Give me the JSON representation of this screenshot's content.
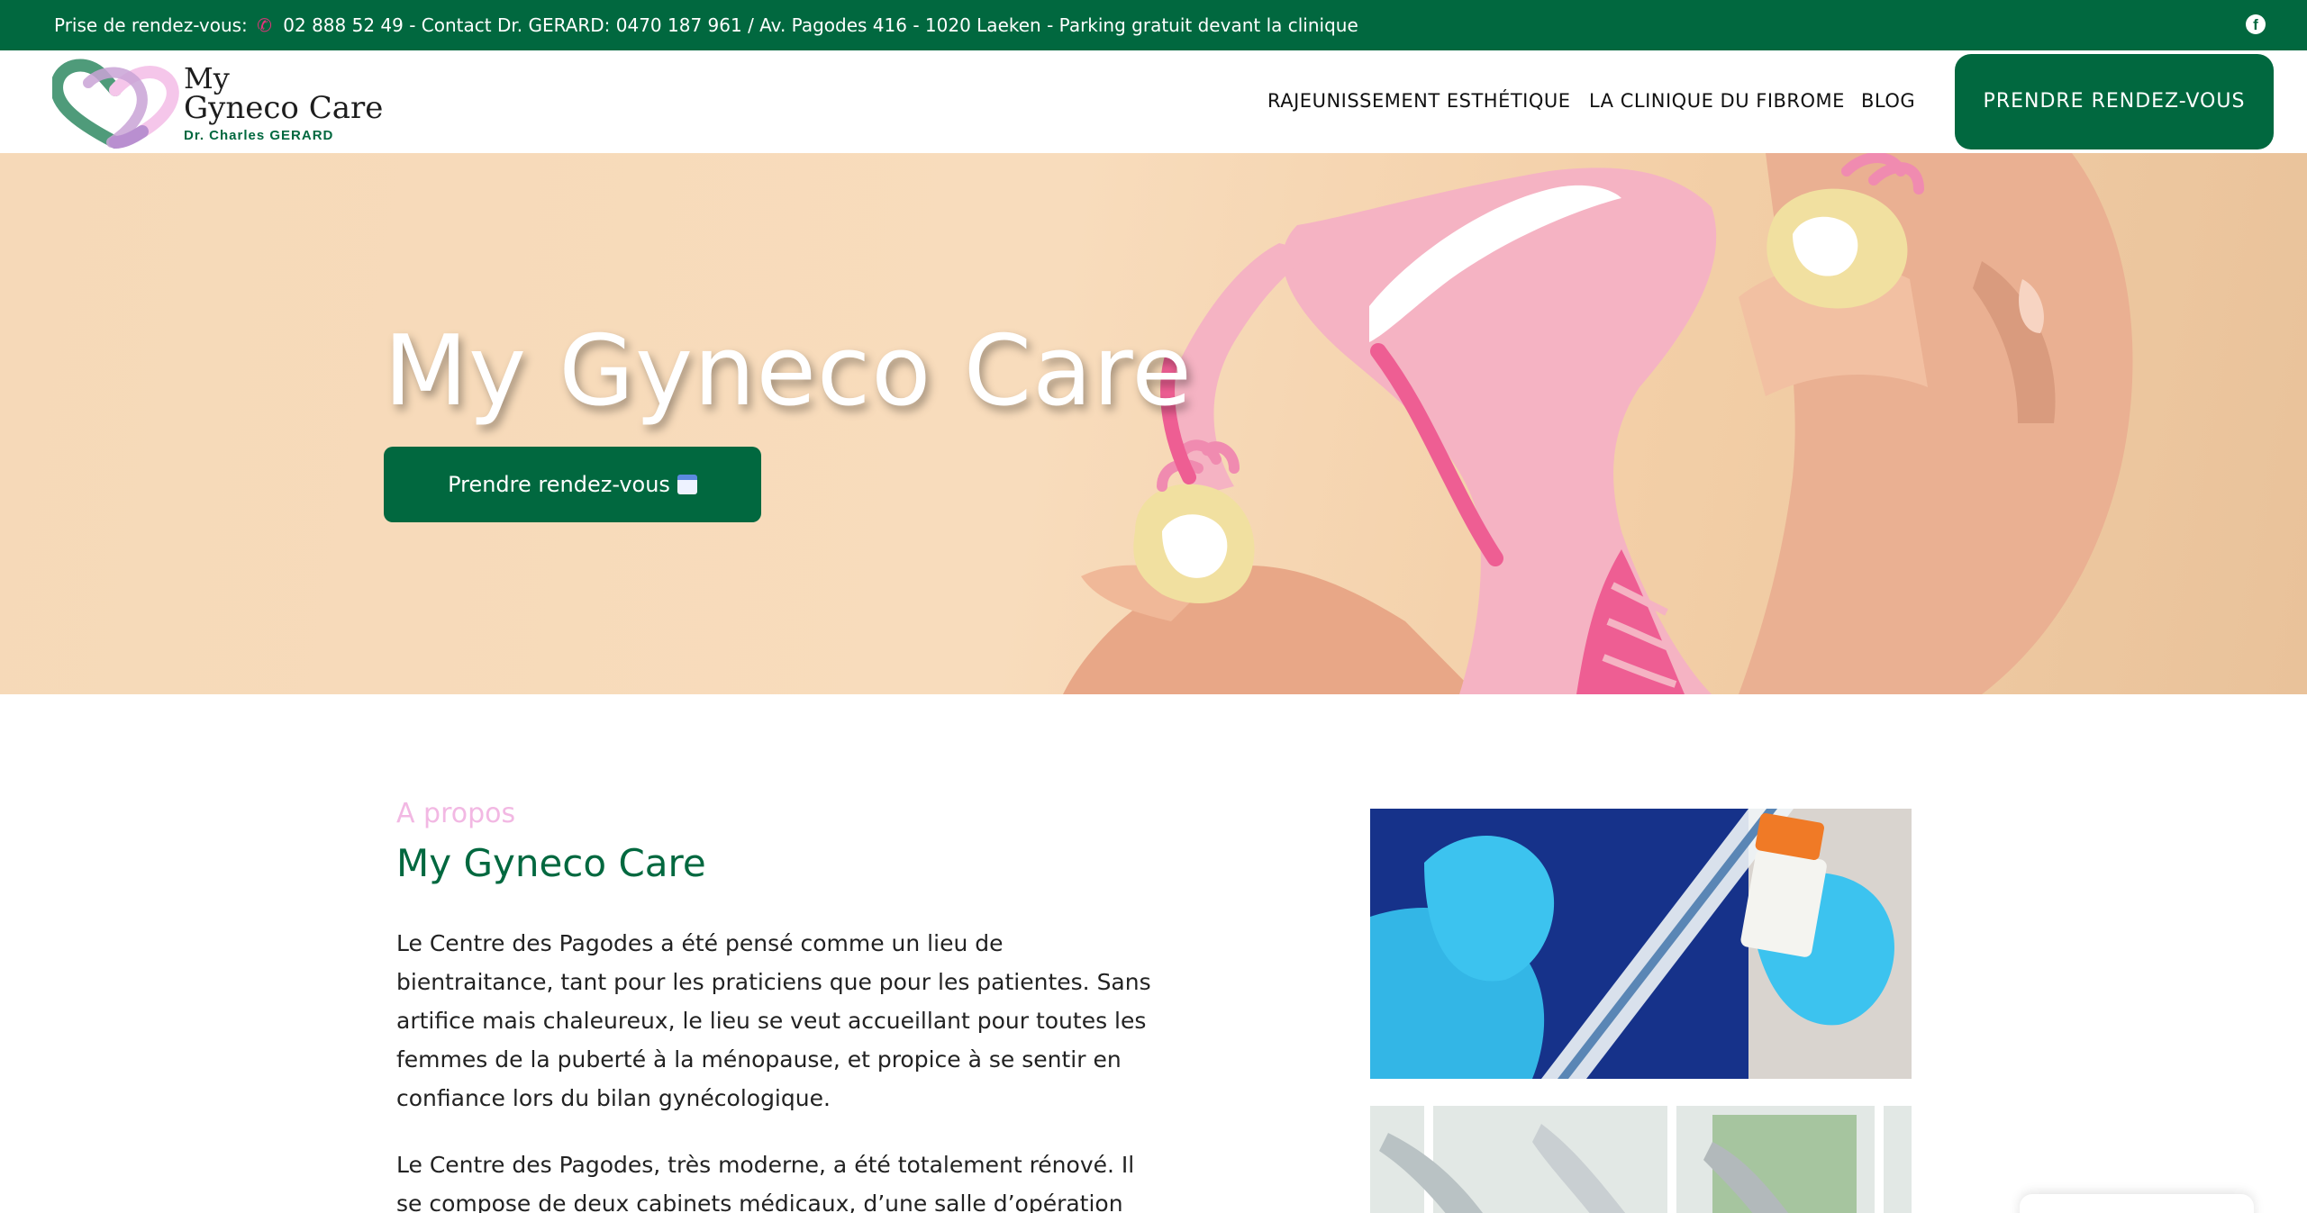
{
  "topbar": {
    "prefix": "Prise de rendez-vous:",
    "info": "02 888 52 49 - Contact Dr. GERARD: 0470 187 961 / Av. Pagodes 416 - 1020 Laeken - Parking gratuit devant la clinique",
    "social_icon": "facebook-icon"
  },
  "logo": {
    "line1": "My",
    "line2": "Gyneco Care",
    "subtitle": "Dr. Charles GERARD"
  },
  "nav": {
    "items": [
      {
        "label": "RAJEUNISSEMENT ESTHÉTIQUE"
      },
      {
        "label": "LA CLINIQUE DU FIBROME"
      },
      {
        "label": "BLOG"
      }
    ],
    "cta": "PRENDRE RENDEZ-VOUS"
  },
  "hero": {
    "title": "My Gyneco Care",
    "button": "Prendre rendez-vous"
  },
  "about": {
    "kicker": "A propos",
    "title": "My Gyneco Care",
    "paragraph1": "Le Centre des Pagodes a été pensé comme un lieu de bientraitance, tant pour les praticiens que pour les patientes. Sans artifice mais chaleureux, le lieu se veut accueillant pour toutes les femmes de la puberté à la ménopause, et propice à se sentir en confiance lors du bilan gynécologique.",
    "paragraph2": "Le Centre des Pagodes, très moderne, a été totalement rénové. Il se compose de deux cabinets médicaux, d’une salle d’opération full"
  },
  "colors": {
    "brand_green": "#01683f",
    "accent_pink": "#f2b8e3",
    "phone_icon": "#e2357a"
  }
}
